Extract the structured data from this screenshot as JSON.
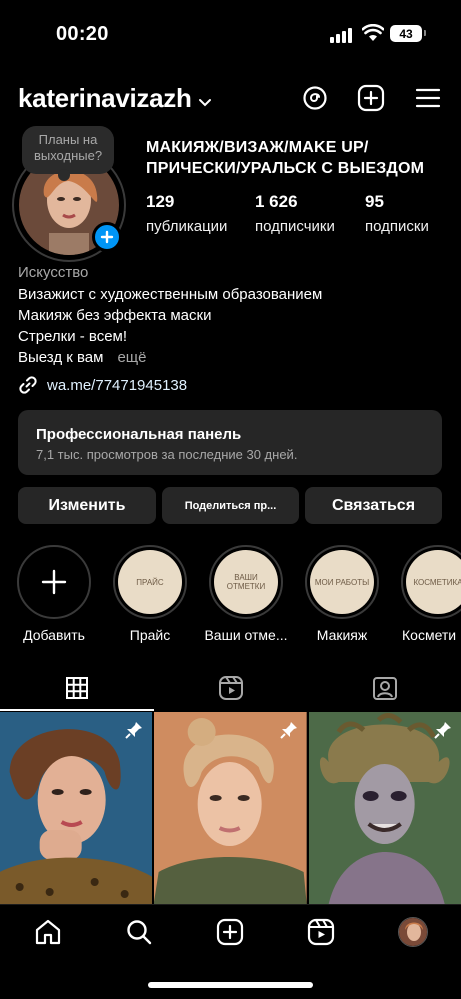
{
  "status_bar": {
    "time": "00:20",
    "battery": "43"
  },
  "header": {
    "username": "katerinavizazh"
  },
  "profile": {
    "note": "Планы на выходные?",
    "title_lines": [
      "МАКИЯЖ/ВИЗАЖ/MAKE UP/",
      "ПРИЧЕСКИ/УРАЛЬСК С ВЫЕЗДОМ"
    ],
    "stats": [
      {
        "num": "129",
        "label": "публикации"
      },
      {
        "num": "1 626",
        "label": "подписчики"
      },
      {
        "num": "95",
        "label": "подписки"
      }
    ],
    "category": "Искусство",
    "bio": [
      "Визажист с художественным образованием",
      "Макияж без эффекта маски",
      "Стрелки - всем!",
      "Выезд к вам"
    ],
    "more": "ещё",
    "link": "wa.me/77471945138"
  },
  "panel": {
    "title": "Профессиональная панель",
    "subtitle": "7,1 тыс. просмотров за последние 30 дней."
  },
  "buttons": {
    "edit": "Изменить",
    "share": "Поделиться пр...",
    "contact": "Связаться"
  },
  "highlights": [
    {
      "label": "Добавить",
      "cover": ""
    },
    {
      "label": "Прайс",
      "cover": "ПРАЙС"
    },
    {
      "label": "Ваши отме...",
      "cover": "ВАШИ ОТМЕТКИ"
    },
    {
      "label": "Макияж",
      "cover": "МОИ РАБОТЫ"
    },
    {
      "label": "Космети",
      "cover": "КОСМЕТИКА"
    }
  ],
  "colors": {
    "accent": "#0095f6",
    "panel_bg": "#262626",
    "highlight_bg": "#e9dcc7"
  }
}
